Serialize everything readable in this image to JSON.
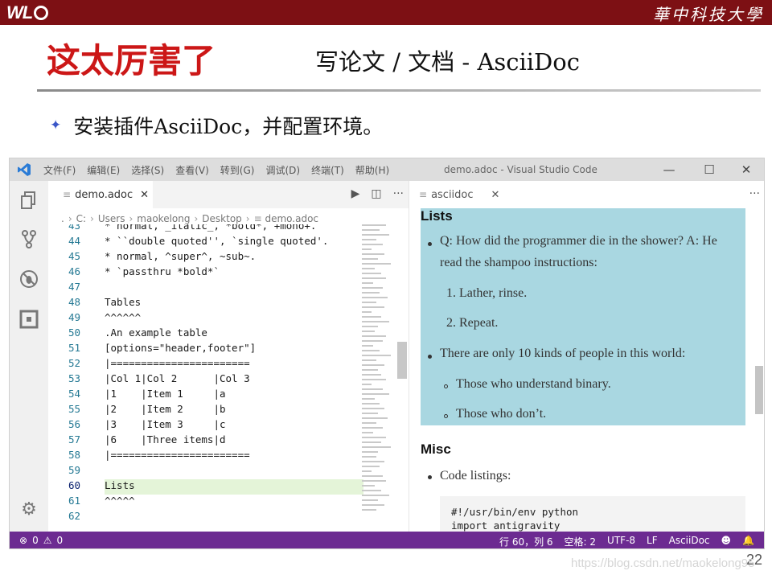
{
  "header": {
    "logo_text": "WL",
    "university": "華中科技大學"
  },
  "slide": {
    "title_main": "这太厉害了",
    "title_sub": "写论文 / 文档 - AsciiDoc",
    "bullet": "安装插件AsciiDoc，并配置环境。",
    "page_number": "22",
    "watermark": "https://blog.csdn.net/maokelong95"
  },
  "vscode": {
    "menu": [
      "文件(F)",
      "编辑(E)",
      "选择(S)",
      "查看(V)",
      "转到(G)",
      "调试(D)",
      "终端(T)",
      "帮助(H)"
    ],
    "window_title": "demo.adoc - Visual Studio Code",
    "editor_tab": "demo.adoc",
    "breadcrumb": [
      ".",
      "C:",
      "Users",
      "maokelong",
      "Desktop",
      "demo.adoc"
    ],
    "code_lines": [
      {
        "n": "43",
        "t": "* normal, _italic_, *bold*, +mono+."
      },
      {
        "n": "44",
        "t": "* ``double quoted'', `single quoted'."
      },
      {
        "n": "45",
        "t": "* normal, ^super^, ~sub~."
      },
      {
        "n": "46",
        "t": "* `passthru *bold*`"
      },
      {
        "n": "47",
        "t": ""
      },
      {
        "n": "48",
        "t": "Tables"
      },
      {
        "n": "49",
        "t": "^^^^^^"
      },
      {
        "n": "50",
        "t": ".An example table"
      },
      {
        "n": "51",
        "t": "[options=\"header,footer\"]"
      },
      {
        "n": "52",
        "t": "|======================="
      },
      {
        "n": "53",
        "t": "|Col 1|Col 2      |Col 3"
      },
      {
        "n": "54",
        "t": "|1    |Item 1     |a"
      },
      {
        "n": "55",
        "t": "|2    |Item 2     |b"
      },
      {
        "n": "56",
        "t": "|3    |Item 3     |c"
      },
      {
        "n": "57",
        "t": "|6    |Three items|d"
      },
      {
        "n": "58",
        "t": "|======================="
      },
      {
        "n": "59",
        "t": ""
      },
      {
        "n": "60",
        "t": "Lists"
      },
      {
        "n": "61",
        "t": "^^^^^"
      },
      {
        "n": "62",
        "t": ""
      }
    ],
    "active_line": "60",
    "preview_tab": "asciidoc",
    "preview": {
      "lists_heading": "Lists",
      "q_line1": "Q: How did the programmer die in the shower? A: He",
      "q_line2": "read the shampoo instructions:",
      "step1": "1. Lather, rinse.",
      "step2": "2. Repeat.",
      "kinds": "There are only 10 kinds of people in this world:",
      "understand": "Those who understand binary.",
      "dont": "Those who don’t.",
      "misc_heading": "Misc",
      "code_listings": "Code listings:",
      "code_line1": "#!/usr/bin/env python",
      "code_line2": "import antigravity"
    },
    "status": {
      "errors": "0",
      "warnings": "0",
      "position": "行 60，列 6",
      "spaces": "空格: 2",
      "encoding": "UTF-8",
      "eol": "LF",
      "language": "AsciiDoc"
    },
    "colors": {
      "statusbar": "#6c2b91",
      "preview_highlight": "#a9d7e1",
      "active_line": "#e4f4d8"
    }
  }
}
